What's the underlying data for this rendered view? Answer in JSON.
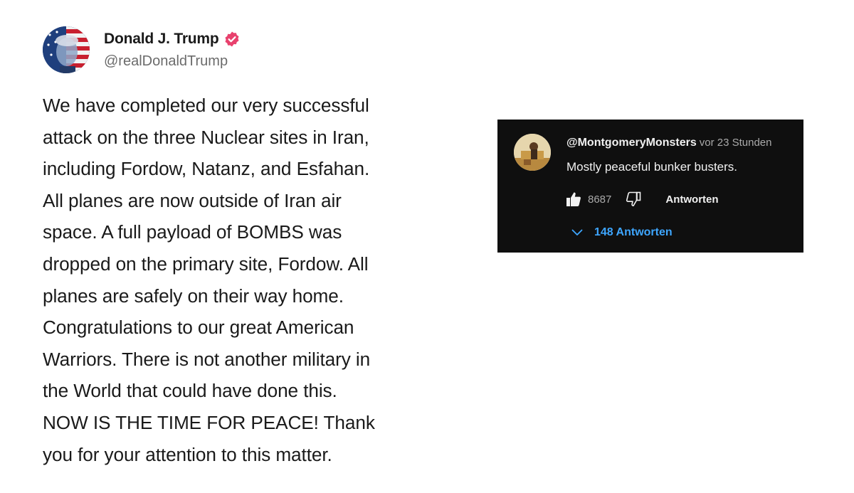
{
  "post": {
    "display_name": "Donald J. Trump",
    "handle": "@realDonaldTrump",
    "verified_color": "#e8416d",
    "body_lines": [
      "We have completed our very successful",
      "attack on the three Nuclear sites in Iran,",
      "including Fordow, Natanz, and Esfahan.",
      "All planes are now outside of Iran air",
      "space. A full payload of BOMBS was",
      "dropped on the primary site, Fordow. All",
      "planes are safely on their way home.",
      "Congratulations to our great American",
      "Warriors. There is not another military in",
      "the World that could have done this.",
      "NOW IS THE TIME FOR PEACE! Thank",
      "you for your attention to this matter."
    ]
  },
  "comment": {
    "author": "@MontgomeryMonsters",
    "time": "vor 23 Stunden",
    "text": "Mostly peaceful bunker busters.",
    "likes": "8687",
    "reply_label": "Antworten",
    "replies_label": "148 Antworten",
    "accent_color": "#3ea6ff",
    "background_color": "#0f0f0f"
  }
}
